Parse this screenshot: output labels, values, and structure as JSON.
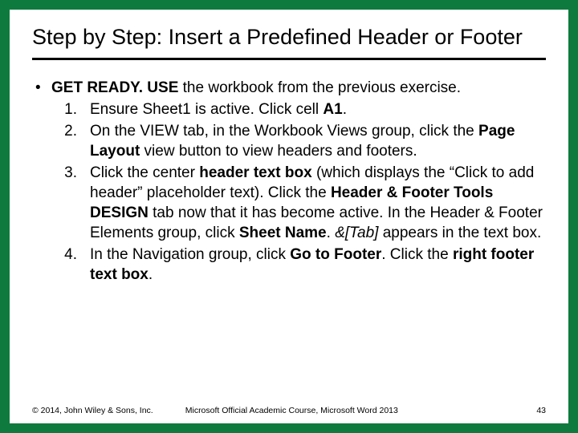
{
  "title": "Step by Step: Insert a Predefined Header or Footer",
  "lead": {
    "bullet": "•",
    "bold_prefix": "GET READY. USE",
    "rest": " the workbook from the previous exercise."
  },
  "steps": [
    {
      "num": "1.",
      "parts": [
        "Ensure Sheet1 is active. Click cell ",
        "A1",
        "."
      ]
    },
    {
      "num": "2.",
      "parts": [
        "On the VIEW tab, in the Workbook Views group, click the ",
        "Page Layout",
        " view button to view headers and footers."
      ]
    },
    {
      "num": "3.",
      "parts": [
        "Click the center ",
        "header text box",
        " (which displays the “Click to add header” placeholder text). Click the ",
        "Header & Footer Tools DESIGN",
        " tab now that it has become active. In the Header & Footer Elements group, click ",
        "Sheet Name",
        ". ",
        "&[Tab]",
        " appears in the text box."
      ]
    },
    {
      "num": "4.",
      "parts": [
        "In the Navigation group, click ",
        "Go to Footer",
        ". Click the ",
        "right footer text box",
        "."
      ]
    }
  ],
  "footer": {
    "left": "© 2014, John Wiley & Sons, Inc.",
    "center": "Microsoft Official Academic Course, Microsoft Word 2013",
    "right": "43"
  }
}
